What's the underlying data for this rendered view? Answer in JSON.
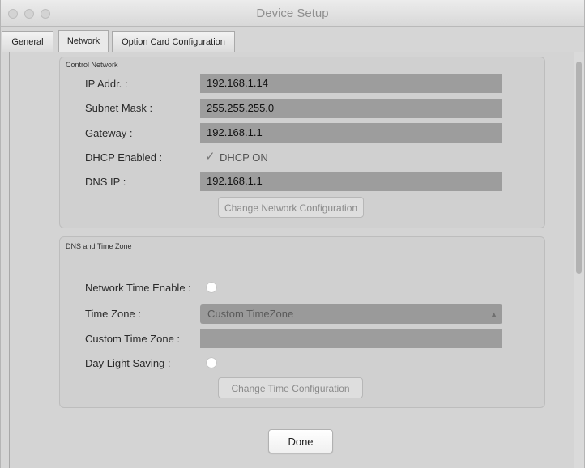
{
  "window": {
    "title": "Device Setup"
  },
  "tabs": [
    {
      "label": "General"
    },
    {
      "label": "Network"
    },
    {
      "label": "Option Card Configuration"
    }
  ],
  "control_network": {
    "title": "Control Network",
    "ip_label": "IP Addr. :",
    "ip_value": "192.168.1.14",
    "subnet_label": "Subnet Mask :",
    "subnet_value": "255.255.255.0",
    "gateway_label": "Gateway :",
    "gateway_value": "192.168.1.1",
    "dhcp_label": "DHCP Enabled :",
    "dhcp_checkbox_label": "DHCP ON",
    "dhcp_checked": true,
    "dns_label": "DNS IP :",
    "dns_value": "192.168.1.1",
    "change_button": "Change Network Configuration"
  },
  "dns_time": {
    "title": "DNS and Time Zone",
    "network_time_label": "Network Time Enable :",
    "time_zone_label": "Time Zone :",
    "time_zone_value": "Custom TimeZone",
    "custom_tz_label": "Custom Time Zone :",
    "custom_tz_value": "",
    "daylight_label": "Day Light Saving :",
    "change_button": "Change Time Configuration"
  },
  "done_button": "Done",
  "icons": {
    "checkmark": "check-icon",
    "select_arrows": "chevron-updown-icon"
  }
}
